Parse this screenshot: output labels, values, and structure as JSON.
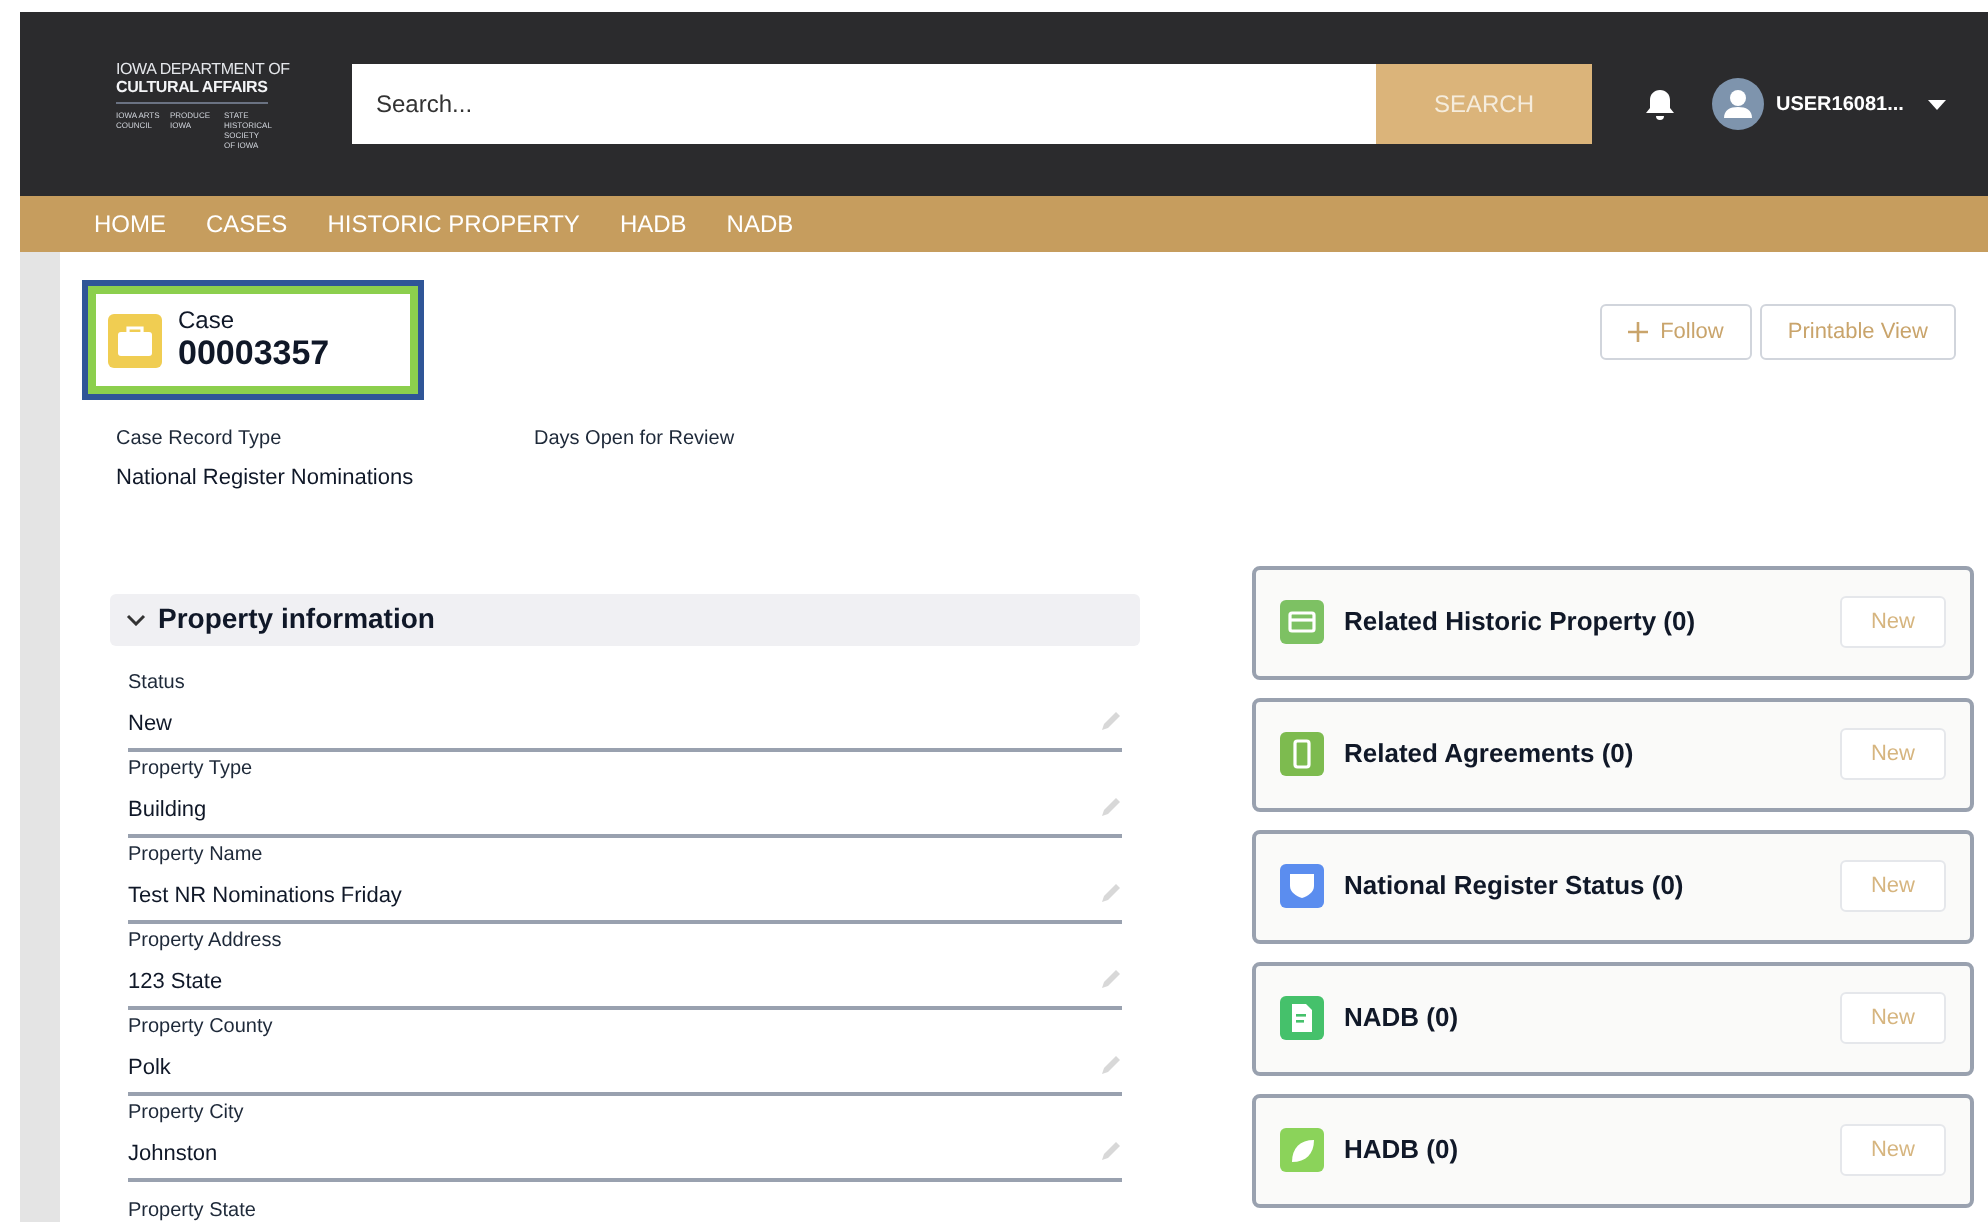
{
  "logo": {
    "line_1": "IOWA DEPARTMENT OF",
    "line_2": "CULTURAL AFFAIRS",
    "divisions": [
      "IOWA ARTS COUNCIL",
      "PRODUCE IOWA",
      "STATE HISTORICAL SOCIETY OF IOWA"
    ]
  },
  "search": {
    "placeholder": "Search...",
    "button": "SEARCH"
  },
  "user": {
    "name": "USER16081..."
  },
  "nav": [
    {
      "label": "HOME"
    },
    {
      "label": "CASES"
    },
    {
      "label": "HISTORIC PROPERTY"
    },
    {
      "label": "HADB"
    },
    {
      "label": "NADB"
    }
  ],
  "record": {
    "type_label": "Case",
    "number": "00003357",
    "highlighted": true
  },
  "actions": [
    {
      "label": "Follow",
      "kind": "follow"
    },
    {
      "label": "Printable View",
      "kind": "plain"
    }
  ],
  "highlights": [
    {
      "label": "Case Record Type",
      "value": "National Register Nominations"
    },
    {
      "label": "Days Open for Review"
    }
  ],
  "section": {
    "title": "Property information",
    "expanded": true,
    "fields": [
      {
        "label": "Status",
        "value": "New"
      },
      {
        "label": "Property Type",
        "value": "Building"
      },
      {
        "label": "Property Name",
        "value": "Test NR Nominations Friday"
      },
      {
        "label": "Property Address",
        "value": "123 State"
      },
      {
        "label": "Property County",
        "value": "Polk"
      },
      {
        "label": "Property City",
        "value": "Johnston"
      },
      {
        "label": "Property State"
      }
    ]
  },
  "related_lists": [
    {
      "title": "Related Historic Property (0)",
      "kind": "card",
      "color": "#7dc163",
      "button": "New"
    },
    {
      "title": "Related Agreements (0)",
      "kind": "device",
      "color": "#7dbb4f",
      "button": "New"
    },
    {
      "title": "National Register Status (0)",
      "kind": "shield",
      "color": "#5b8def",
      "button": "New"
    },
    {
      "title": "NADB (0)",
      "kind": "document",
      "color": "#45c16b",
      "button": "New"
    },
    {
      "title": "HADB (0)",
      "kind": "leaf",
      "color": "#8bd35a",
      "button": "New"
    }
  ]
}
